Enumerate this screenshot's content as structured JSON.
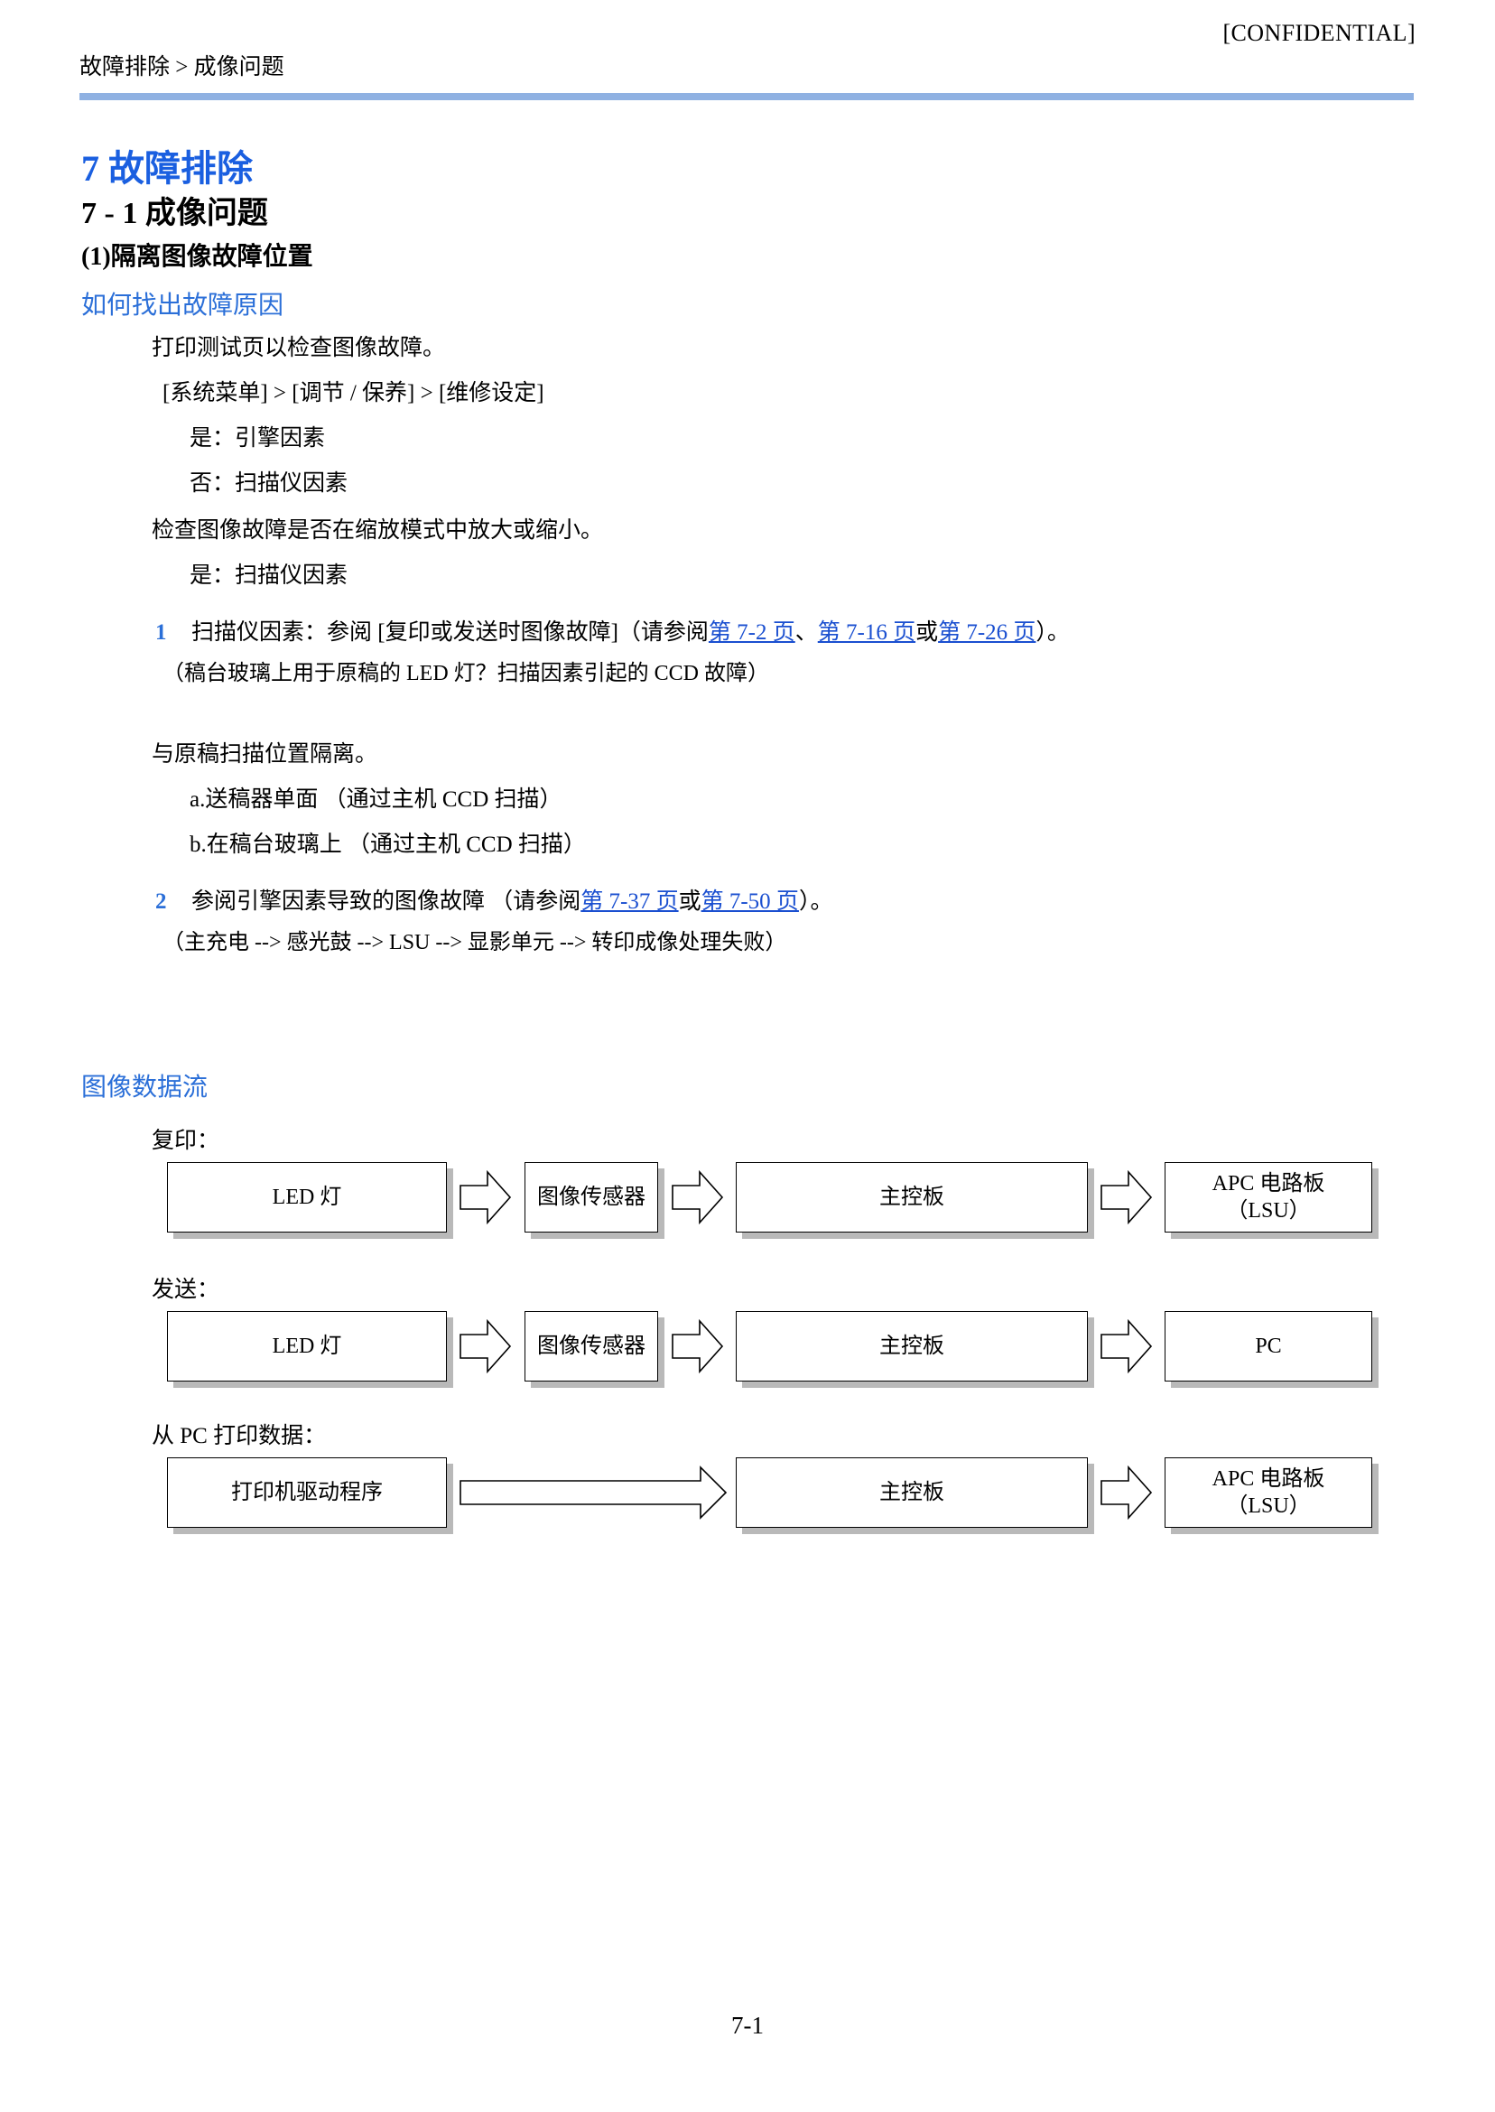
{
  "header": {
    "confidential": "[CONFIDENTIAL]",
    "breadcrumb": "故障排除 > 成像问题"
  },
  "titles": {
    "chapter": "7 故障排除",
    "section": "7 - 1 成像问题",
    "subsection": "(1)隔离图像故障位置",
    "how_to_find": "如何找出故障原因",
    "image_data_flow": "图像数据流"
  },
  "body": {
    "line_print_test": "打印测试页以检查图像故障。",
    "line_menu_path": "[系统菜单] > [调节 / 保养] > [维修设定]",
    "line_yes_engine": "是：引擎因素",
    "line_no_scanner": "否：扫描仪因素",
    "line_check_zoom": "检查图像故障是否在缩放模式中放大或缩小。",
    "line_yes_scanner": "是：扫描仪因素",
    "item1": {
      "number": "1",
      "text_before": "扫描仪因素：参阅 [复印或发送时图像故障]（请参阅",
      "link1": "第 7-2 页",
      "sep1": "、",
      "link2": "第 7-16 页",
      "sep2": "或",
      "link3": "第 7-26 页",
      "text_after": "）。",
      "note": "（稿台玻璃上用于原稿的 LED 灯？扫描因素引起的 CCD 故障）"
    },
    "line_isolate": "与原稿扫描位置隔离。",
    "line_a": "a.送稿器单面 （通过主机 CCD 扫描）",
    "line_b": "b.在稿台玻璃上 （通过主机 CCD 扫描）",
    "item2": {
      "number": "2",
      "text_before": "参阅引擎因素导致的图像故障 （请参阅",
      "link1": "第 7-37 页",
      "sep1": "或",
      "link2": "第 7-50 页",
      "text_after": "）。",
      "note": "（主充电 --> 感光鼓 --> LSU --> 显影单元 --> 转印成像处理失败）"
    }
  },
  "flow": {
    "rows": [
      {
        "label": "复印：",
        "boxes": [
          "LED 灯",
          "图像传感器",
          "主控板",
          "APC 电路板\n（LSU）"
        ]
      },
      {
        "label": "发送：",
        "boxes": [
          "LED 灯",
          "图像传感器",
          "主控板",
          "PC"
        ]
      },
      {
        "label": "从 PC 打印数据：",
        "boxes": [
          "打印机驱动程序",
          "主控板",
          "APC 电路板\n（LSU）"
        ]
      }
    ]
  },
  "footer": {
    "page_number": "7-1"
  },
  "colors": {
    "accent_blue": "#2b6fd8",
    "rule_blue": "#8fb1e2",
    "link_blue": "#1a4fd0",
    "box_shadow": "#b9b9b9"
  }
}
